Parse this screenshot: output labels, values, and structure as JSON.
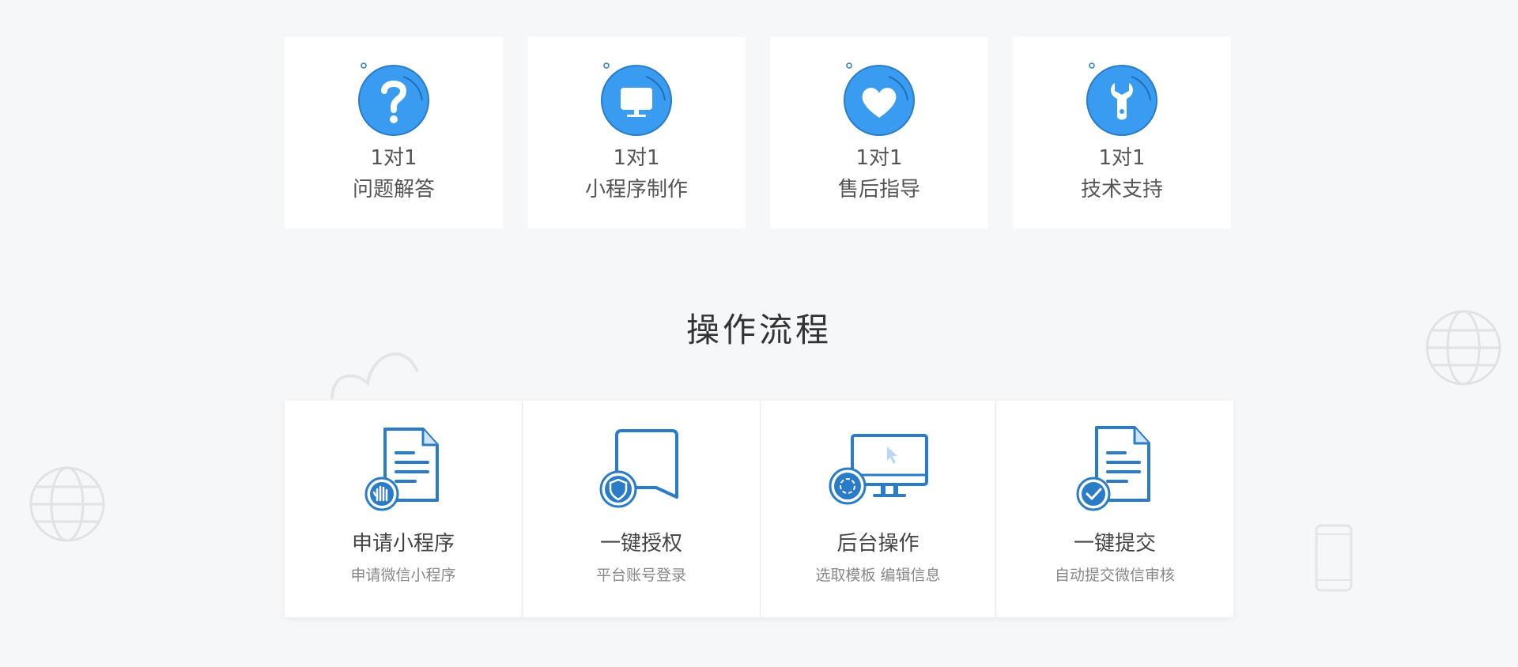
{
  "colors": {
    "background": "#f6f7f9",
    "card": "#ffffff",
    "accent_blue": "#3a9cf0",
    "icon_stroke": "#2b7cc7",
    "text_main": "#555555",
    "text_desc": "#888888"
  },
  "services": [
    {
      "line1": "1对1",
      "line2": "问题解答",
      "icon": "question-icon"
    },
    {
      "line1": "1对1",
      "line2": "小程序制作",
      "icon": "monitor-icon"
    },
    {
      "line1": "1对1",
      "line2": "售后指导",
      "icon": "heart-icon"
    },
    {
      "line1": "1对1",
      "line2": "技术支持",
      "icon": "wrench-icon"
    }
  ],
  "process": {
    "title": "操作流程",
    "steps": [
      {
        "title": "申请小程序",
        "desc": "申请微信小程序",
        "icon": "document-hand-icon"
      },
      {
        "title": "一键授权",
        "desc": "平台账号登录",
        "icon": "chat-shield-icon"
      },
      {
        "title": "后台操作",
        "desc": "选取模板 编辑信息",
        "icon": "monitor-cursor-icon"
      },
      {
        "title": "一键提交",
        "desc": "自动提交微信审核",
        "icon": "document-check-icon"
      }
    ]
  }
}
